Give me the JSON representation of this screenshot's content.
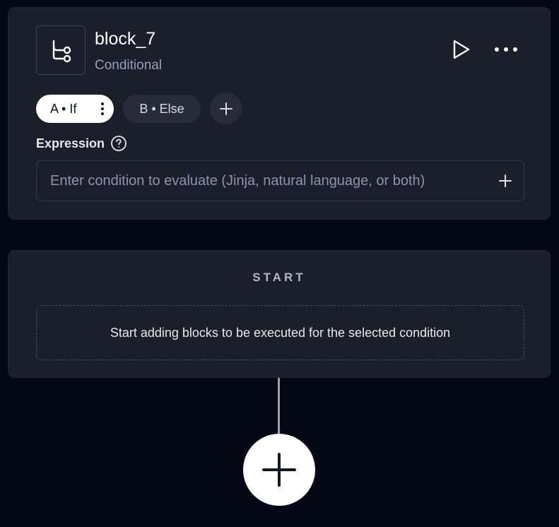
{
  "block": {
    "icon": "conditional-branch-icon",
    "title": "block_7",
    "type_label": "Conditional",
    "run_icon": "play-icon",
    "more_icon": "ellipsis-icon"
  },
  "tabs": [
    {
      "label": "A • If",
      "selected": true,
      "menu_icon": "vertical-ellipsis-icon"
    },
    {
      "label": "B • Else",
      "selected": false
    }
  ],
  "add_tab_icon": "plus-icon",
  "expression": {
    "label": "Expression",
    "help_icon": "question-circle-icon",
    "placeholder": "Enter condition to evaluate (Jinja, natural language, or both)",
    "value": "",
    "add_icon": "plus-icon"
  },
  "branch": {
    "header": "START",
    "empty_message": "Start adding blocks to be executed for the selected condition"
  },
  "add_block_icon": "plus-icon",
  "colors": {
    "background": "#040814",
    "card": "#1b1f2c",
    "selected_tab": "#ffffff",
    "unselected_tab": "#272c3a"
  }
}
